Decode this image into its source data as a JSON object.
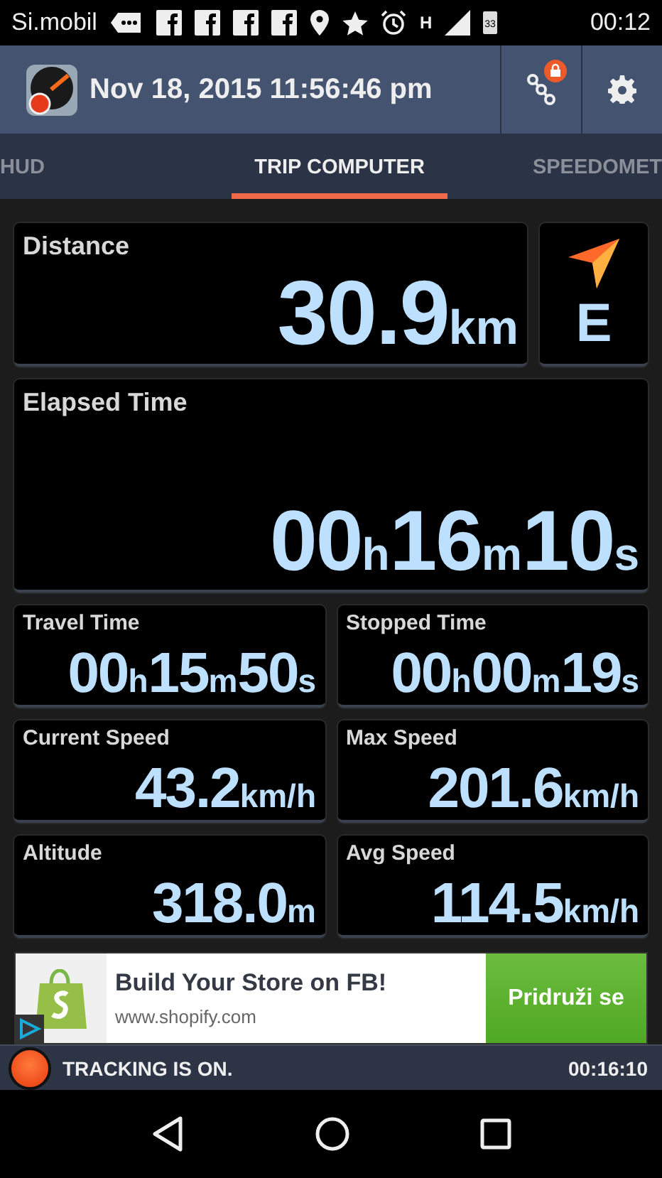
{
  "status_bar": {
    "carrier": "Si.mobil",
    "battery_text": "33",
    "network": "H",
    "time": "00:12"
  },
  "header": {
    "datetime": "Nov 18, 2015 11:56:46 pm"
  },
  "tabs": [
    {
      "label": "HUD",
      "selected": false
    },
    {
      "label": "TRIP COMPUTER",
      "selected": true
    },
    {
      "label": "SPEEDOMET",
      "selected": false
    }
  ],
  "distance": {
    "label": "Distance",
    "value": [
      {
        "text": "30.9",
        "kind": "number"
      },
      {
        "text": "km",
        "kind": "unit"
      }
    ]
  },
  "heading": {
    "direction": "E"
  },
  "elapsed": {
    "label": "Elapsed Time",
    "value": [
      {
        "text": "00",
        "kind": "number"
      },
      {
        "text": "h",
        "kind": "unit"
      },
      {
        "text": "16",
        "kind": "number"
      },
      {
        "text": "m",
        "kind": "unit"
      },
      {
        "text": "10",
        "kind": "number"
      },
      {
        "text": "s",
        "kind": "unit"
      }
    ]
  },
  "stats": [
    {
      "label": "Travel Time",
      "value": [
        {
          "text": "00",
          "kind": "number"
        },
        {
          "text": "h",
          "kind": "unit"
        },
        {
          "text": "15",
          "kind": "number"
        },
        {
          "text": "m",
          "kind": "unit"
        },
        {
          "text": "50",
          "kind": "number"
        },
        {
          "text": "s",
          "kind": "unit"
        }
      ]
    },
    {
      "label": "Stopped Time",
      "value": [
        {
          "text": "00",
          "kind": "number"
        },
        {
          "text": "h",
          "kind": "unit"
        },
        {
          "text": "00",
          "kind": "number"
        },
        {
          "text": "m",
          "kind": "unit"
        },
        {
          "text": "19",
          "kind": "number"
        },
        {
          "text": "s",
          "kind": "unit"
        }
      ]
    },
    {
      "label": "Current Speed",
      "value": [
        {
          "text": "43.2",
          "kind": "number"
        },
        {
          "text": "km/h",
          "kind": "unit"
        }
      ]
    },
    {
      "label": "Max Speed",
      "value": [
        {
          "text": "201.6",
          "kind": "number"
        },
        {
          "text": "km/h",
          "kind": "unit"
        }
      ]
    },
    {
      "label": "Altitude",
      "value": [
        {
          "text": "318.0",
          "kind": "number"
        },
        {
          "text": "m",
          "kind": "unit"
        }
      ]
    },
    {
      "label": "Avg Speed",
      "value": [
        {
          "text": "114.5",
          "kind": "number"
        },
        {
          "text": "km/h",
          "kind": "unit"
        }
      ]
    }
  ],
  "ad": {
    "title": "Build Your Store on FB!",
    "url": "www.shopify.com",
    "button": "Pridruži se"
  },
  "tracking": {
    "status": "TRACKING IS ON.",
    "duration": "00:16:10",
    "on": true
  }
}
